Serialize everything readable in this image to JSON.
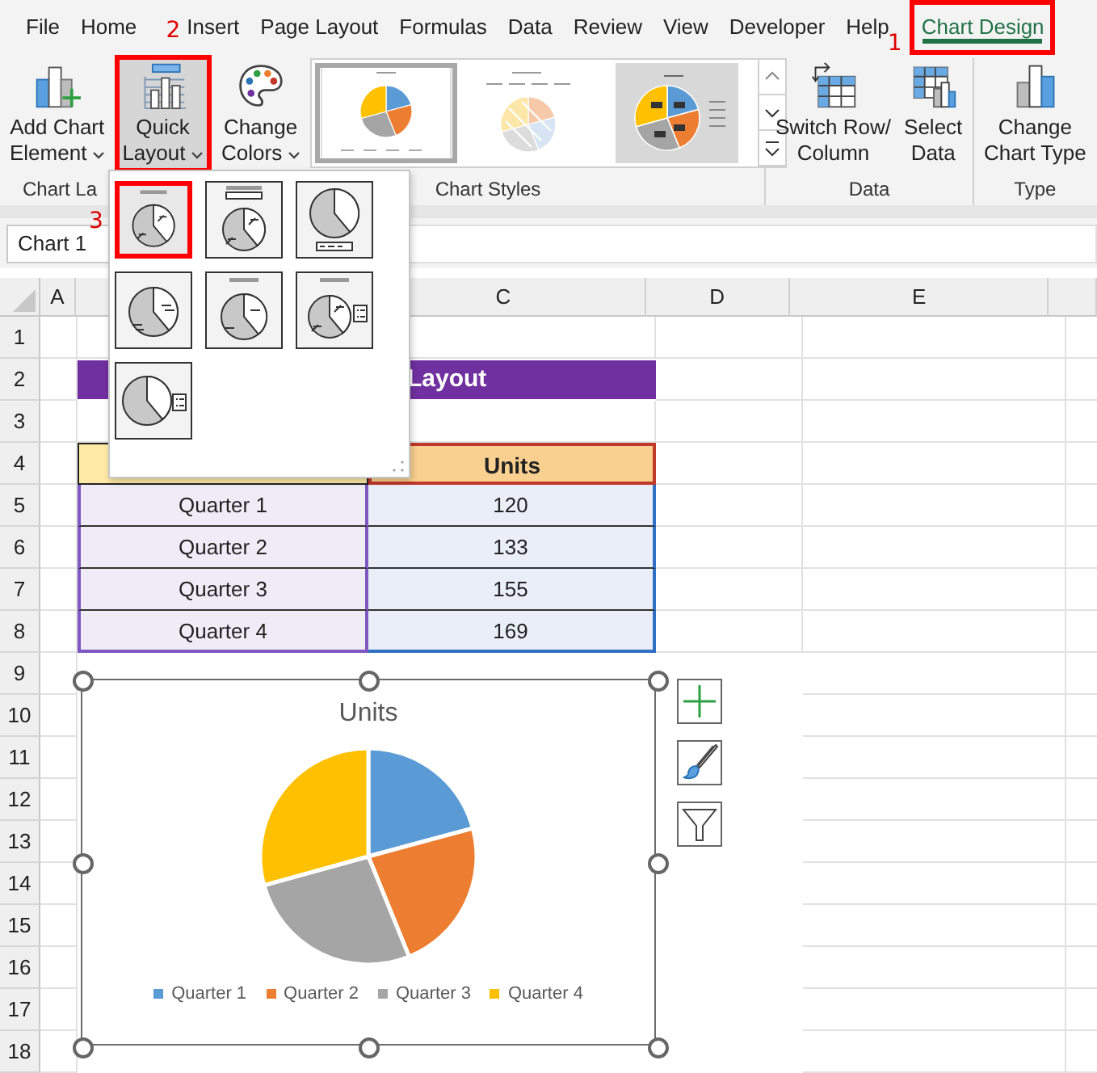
{
  "menu_tabs": [
    {
      "label": "File",
      "selected": false,
      "highlighted": false
    },
    {
      "label": "Home",
      "selected": false,
      "highlighted": false
    },
    {
      "label": "Insert",
      "selected": false,
      "highlighted": false
    },
    {
      "label": "Page Layout",
      "selected": false,
      "highlighted": false
    },
    {
      "label": "Formulas",
      "selected": false,
      "highlighted": false
    },
    {
      "label": "Data",
      "selected": false,
      "highlighted": false
    },
    {
      "label": "Review",
      "selected": false,
      "highlighted": false
    },
    {
      "label": "View",
      "selected": false,
      "highlighted": false
    },
    {
      "label": "Developer",
      "selected": false,
      "highlighted": false
    },
    {
      "label": "Help",
      "selected": false,
      "highlighted": false
    },
    {
      "label": "Chart Design",
      "selected": true,
      "highlighted": true,
      "callout": "1"
    }
  ],
  "ribbon": {
    "groups": [
      {
        "label": "Chart La",
        "buttons": [
          {
            "kind": "add-element",
            "lines": [
              "Add Chart",
              "Element"
            ],
            "dropdown": true,
            "highlighted": false
          },
          {
            "kind": "quick-layout",
            "lines": [
              "Quick",
              "Layout"
            ],
            "dropdown": true,
            "highlighted": true,
            "callout": "2"
          }
        ]
      },
      {
        "label": "Chart Styles",
        "buttons": [
          {
            "kind": "change-colors",
            "lines": [
              "Change",
              "Colors"
            ],
            "dropdown": true,
            "highlighted": false
          }
        ],
        "styles": [
          {
            "kind": "plain",
            "selected": true
          },
          {
            "kind": "hatched",
            "selected": false
          },
          {
            "kind": "shaded",
            "selected": false
          }
        ]
      },
      {
        "label": "Data",
        "buttons": [
          {
            "kind": "switch",
            "lines": [
              "Switch Row/",
              "Column"
            ],
            "dropdown": false,
            "highlighted": false
          },
          {
            "kind": "select-data",
            "lines": [
              "Select",
              "Data"
            ],
            "dropdown": false,
            "highlighted": false
          }
        ]
      },
      {
        "label": "Type",
        "buttons": [
          {
            "kind": "change-type",
            "lines": [
              "Change",
              "Chart Type"
            ],
            "dropdown": false,
            "highlighted": false
          }
        ]
      }
    ]
  },
  "name_box": "Chart 1",
  "quick_layout_menu": {
    "items": [
      {
        "kind": "title-labels",
        "selected": true,
        "callout": "3"
      },
      {
        "kind": "title-legend-labels",
        "selected": false
      },
      {
        "kind": "legend-bottom",
        "selected": false
      },
      {
        "kind": "lines-labels",
        "selected": false
      },
      {
        "kind": "title-lines",
        "selected": false
      },
      {
        "kind": "title-labels-legend",
        "selected": false
      },
      {
        "kind": "legend-right",
        "selected": false
      }
    ]
  },
  "sheet": {
    "columns": [
      "A",
      "C",
      "D",
      "E"
    ],
    "rows": [
      "1",
      "2",
      "3",
      "4",
      "5",
      "6",
      "7",
      "8",
      "9",
      "10",
      "11",
      "12",
      "13",
      "14",
      "15",
      "16",
      "17",
      "18"
    ],
    "banner": "Layout",
    "table": {
      "value_header": "Units",
      "rows": [
        {
          "quarter": "Quarter 1",
          "units": "120"
        },
        {
          "quarter": "Quarter 2",
          "units": "133"
        },
        {
          "quarter": "Quarter 3",
          "units": "155"
        },
        {
          "quarter": "Quarter 4",
          "units": "169"
        }
      ]
    }
  },
  "chart": {
    "slices": [
      {
        "color": "#5b9bd5"
      },
      {
        "color": "#ed7d31"
      },
      {
        "color": "#a5a5a5"
      },
      {
        "color": "#ffc000"
      }
    ],
    "chart_data": {
      "type": "pie",
      "title": "Units",
      "legend": "bottom",
      "categories": [
        "Quarter 1",
        "Quarter 2",
        "Quarter 3",
        "Quarter 4"
      ],
      "values": [
        20.8,
        23.05,
        26.86,
        29.29
      ]
    }
  }
}
